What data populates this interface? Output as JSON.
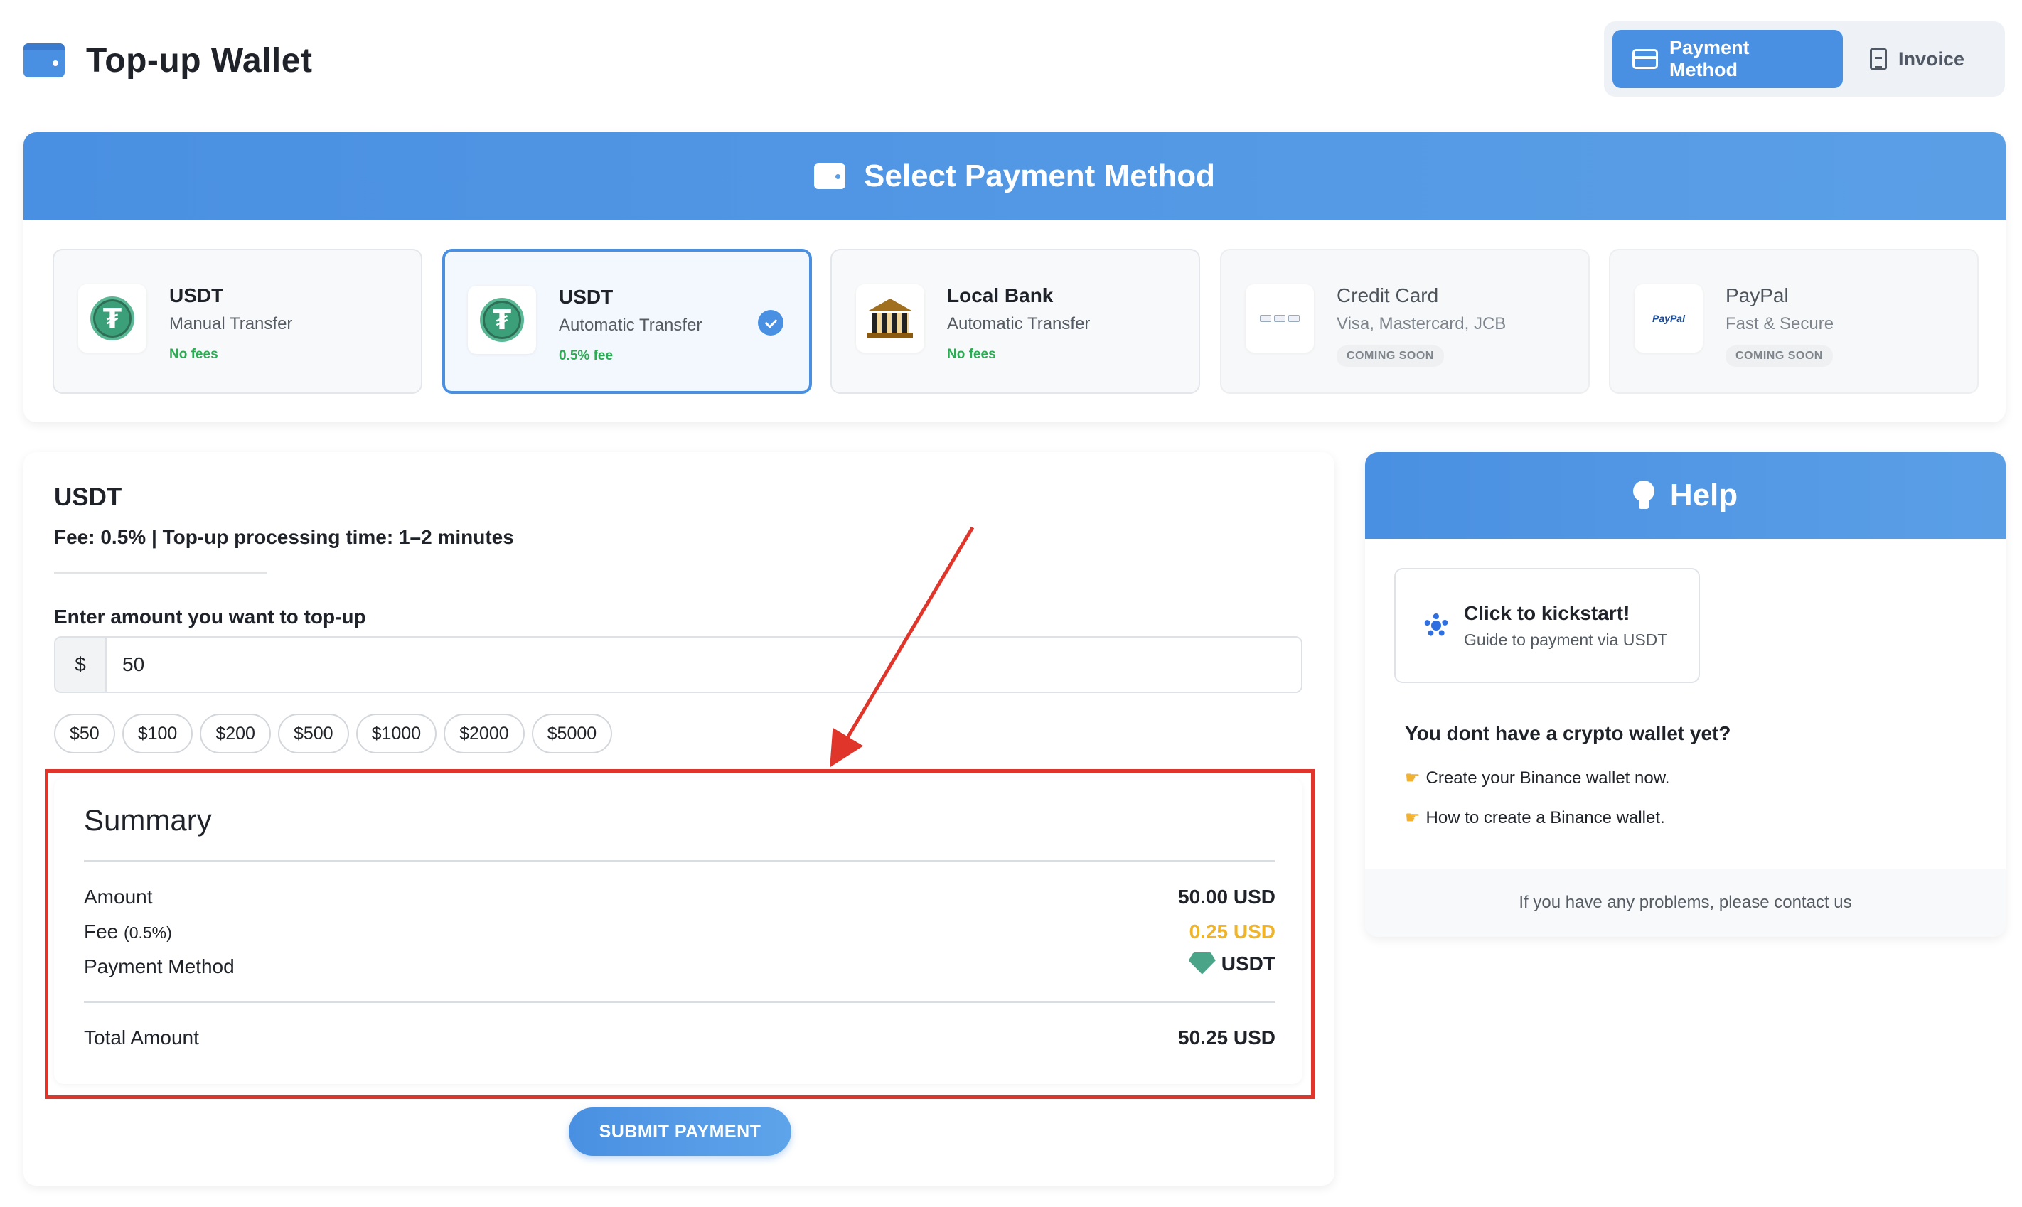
{
  "header": {
    "title": "Top-up Wallet",
    "tabs": [
      {
        "label": "Payment Method",
        "active": true,
        "icon": "credit-card-icon"
      },
      {
        "label": "Invoice",
        "active": false,
        "icon": "document-icon"
      }
    ]
  },
  "payment_section": {
    "title": "Select Payment Method",
    "methods": [
      {
        "name": "USDT",
        "subtitle": "Manual Transfer",
        "fee": "No fees",
        "icon": "tether-icon",
        "selected": false
      },
      {
        "name": "USDT",
        "subtitle": "Automatic Transfer",
        "fee": "0.5% fee",
        "icon": "tether-icon",
        "selected": true
      },
      {
        "name": "Local Bank",
        "subtitle": "Automatic Transfer",
        "fee": "No fees",
        "icon": "bank-icon",
        "selected": false
      },
      {
        "name": "Credit Card",
        "subtitle": "Visa, Mastercard, JCB",
        "badge": "COMING SOON",
        "icon": "credit-card-logos-icon",
        "disabled": true
      },
      {
        "name": "PayPal",
        "subtitle": "Fast & Secure",
        "badge": "COMING SOON",
        "icon": "paypal-icon",
        "disabled": true,
        "logo_text": "PayPal"
      }
    ]
  },
  "form": {
    "method_title": "USDT",
    "description": "Fee: 0.5% | Top-up processing time: 1–2 minutes",
    "amount_label": "Enter amount you want to top-up",
    "currency_symbol": "$",
    "amount_value": "50",
    "presets": [
      "$50",
      "$100",
      "$200",
      "$500",
      "$1000",
      "$2000",
      "$5000"
    ],
    "summary": {
      "title": "Summary",
      "amount_label": "Amount",
      "amount_value": "50.00 USD",
      "fee_label": "Fee",
      "fee_percent": "(0.5%)",
      "fee_value": "0.25 USD",
      "method_label": "Payment Method",
      "method_value": "USDT",
      "total_label": "Total Amount",
      "total_value": "50.25 USD"
    },
    "submit_label": "SUBMIT PAYMENT"
  },
  "help": {
    "title": "Help",
    "kickstart_title": "Click to kickstart!",
    "kickstart_sub": "Guide to payment via USDT",
    "wallet_question": "You dont have a crypto wallet yet?",
    "links": [
      "Create your Binance wallet now.",
      "How to create a Binance wallet."
    ],
    "footer": "If you have any problems, please contact us"
  },
  "colors": {
    "accent": "#4a90e2",
    "fee_green": "#2bab53",
    "fee_orange": "#f0b429",
    "annotation_red": "#e0352b"
  }
}
